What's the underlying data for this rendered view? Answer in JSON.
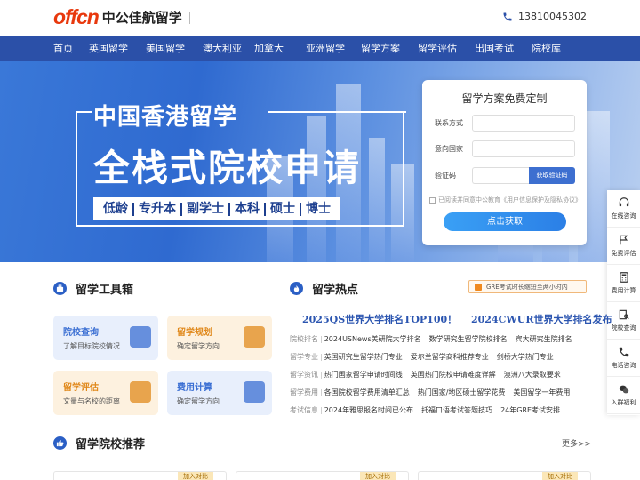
{
  "header": {
    "logo_mark": "offcn",
    "logo_text": "中公佳航留学",
    "phone": "13810045302"
  },
  "nav": [
    "首页",
    "英国留学",
    "美国留学",
    "澳大利亚",
    "加拿大",
    "亚洲留学",
    "留学方案",
    "留学评估",
    "出国考试",
    "院校库"
  ],
  "banner": {
    "title1": "中国香港留学",
    "title2": "全栈式院校申请",
    "tags": [
      "低龄",
      "专升本",
      "副学士",
      "本科",
      "硕士",
      "博士"
    ]
  },
  "form": {
    "title": "留学方案免费定制",
    "contact_label": "联系方式",
    "country_label": "意向国家",
    "code_label": "验证码",
    "code_button": "获取验证码",
    "agree_text": "已阅读并同意中公教育《用户信息保护及隐私协议》",
    "submit": "点击获取"
  },
  "sidebar": [
    {
      "label": "在线咨询",
      "icon": "headset-icon"
    },
    {
      "label": "免费评估",
      "icon": "flag-icon"
    },
    {
      "label": "费用计算",
      "icon": "calculator-icon"
    },
    {
      "label": "院校查询",
      "icon": "school-search-icon"
    },
    {
      "label": "电话咨询",
      "icon": "phone-icon"
    },
    {
      "label": "入群福利",
      "icon": "wechat-icon"
    }
  ],
  "toolbox": {
    "title": "留学工具箱",
    "cards": [
      {
        "title": "院校查询",
        "desc": "了解目标院校情况",
        "color": "#3b6fd3",
        "bg": "#e8effc"
      },
      {
        "title": "留学规划",
        "desc": "确定留学方向",
        "color": "#e0891c",
        "bg": "#fdf1df"
      },
      {
        "title": "留学评估",
        "desc": "文量与名校的距离",
        "color": "#e0891c",
        "bg": "#fdf1df"
      },
      {
        "title": "费用计算",
        "desc": "确定留学方向",
        "color": "#3b6fd3",
        "bg": "#e8effc"
      }
    ]
  },
  "hot": {
    "title": "留学热点",
    "tag": "GRE考试时长缩短至两小时内",
    "headlines": [
      "2025QS世界大学排名TOP100！",
      "2024CWUR世界大学排名发布"
    ],
    "rows": [
      {
        "cat": "院校排名",
        "items": [
          "2024USNews美研院大学排名",
          "数学研究生留学院校排名",
          "宾大研究生院排名"
        ]
      },
      {
        "cat": "留学专业",
        "items": [
          "英国研究生留学热门专业",
          "爱尔兰留学商科推荐专业",
          "剑桥大学热门专业"
        ]
      },
      {
        "cat": "留学资讯",
        "items": [
          "热门国家留学申请时间线",
          "英国热门院校申请难度详解",
          "澳洲八大录取要求"
        ]
      },
      {
        "cat": "留学费用",
        "items": [
          "各国院校留学费用清单汇总",
          "热门国家/地区硕士留学花费",
          "美国留学一年费用"
        ]
      },
      {
        "cat": "考试信息",
        "items": [
          "2024年雅思报名时间已公布",
          "托福口语考试答题技巧",
          "24年GRE考试安排"
        ]
      }
    ]
  },
  "recommend": {
    "title": "留学院校推荐",
    "more": "更多>>",
    "compare": "加入对比"
  }
}
